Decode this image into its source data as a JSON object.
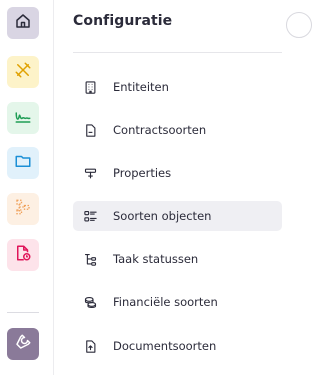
{
  "rail": {
    "items": [
      {
        "icon": "home-icon",
        "bg": "#d9d5e3",
        "fg": "#2b2b3a"
      },
      {
        "icon": "tools-icon",
        "bg": "#fdf3c9",
        "fg": "#e0a100"
      },
      {
        "icon": "signature-icon",
        "bg": "#e4f6ea",
        "fg": "#1f9d55"
      },
      {
        "icon": "folder-icon",
        "bg": "#e1f1fb",
        "fg": "#1b8fd6"
      },
      {
        "icon": "hierarchy-icon",
        "bg": "#fdf0e3",
        "fg": "#f0a15a"
      },
      {
        "icon": "document-clock-icon",
        "bg": "#fde3ea",
        "fg": "#e0155a"
      },
      {
        "icon": "wrench-icon",
        "bg": "#8a7a99",
        "fg": "#ffffff"
      }
    ]
  },
  "panel": {
    "title": "Configuratie",
    "items": [
      {
        "label": "Entiteiten",
        "icon": "building-icon",
        "active": false
      },
      {
        "label": "Contractsoorten",
        "icon": "document-icon",
        "active": false
      },
      {
        "label": "Properties",
        "icon": "properties-icon",
        "active": false
      },
      {
        "label": "Soorten objecten",
        "icon": "object-list-icon",
        "active": true
      },
      {
        "label": "Taak statussen",
        "icon": "task-tree-icon",
        "active": false
      },
      {
        "label": "Financiële soorten",
        "icon": "coins-icon",
        "active": false
      },
      {
        "label": "Documentsoorten",
        "icon": "file-upload-icon",
        "active": false
      }
    ]
  }
}
